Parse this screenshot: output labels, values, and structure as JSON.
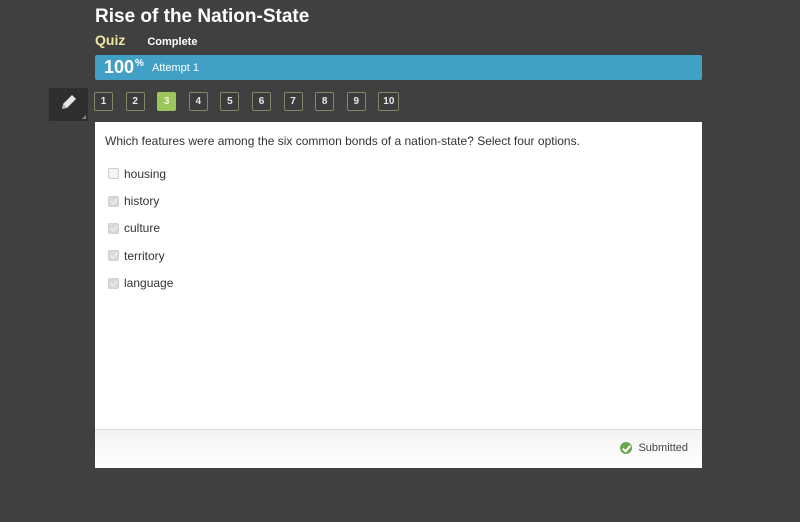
{
  "header": {
    "title": "Rise of the Nation-State",
    "type_label": "Quiz",
    "status_label": "Complete"
  },
  "score_bar": {
    "score": "100",
    "unit": "%",
    "attempt": "Attempt 1",
    "color": "#42a0c6"
  },
  "toolbar": {
    "pencil_icon": "pencil-icon"
  },
  "question_nav": {
    "items": [
      "1",
      "2",
      "3",
      "4",
      "5",
      "6",
      "7",
      "8",
      "9",
      "10"
    ],
    "active": "3",
    "active_color": "#9cc65a"
  },
  "question": {
    "prompt": "Which features were among the six common bonds of a nation-state? Select four options.",
    "options": [
      {
        "label": "housing",
        "checked": false
      },
      {
        "label": "history",
        "checked": true
      },
      {
        "label": "culture",
        "checked": true
      },
      {
        "label": "territory",
        "checked": true
      },
      {
        "label": "language",
        "checked": true
      }
    ]
  },
  "footer": {
    "status": "Submitted",
    "status_icon": "check-circle-icon",
    "status_color": "#6aa84f"
  }
}
